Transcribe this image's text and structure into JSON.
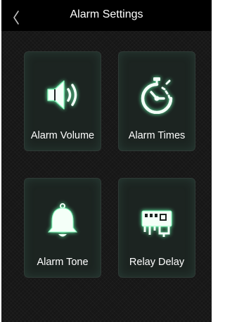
{
  "header": {
    "title": "Alarm Settings",
    "back_icon": "chevron-left-icon"
  },
  "tiles": [
    {
      "label": "Alarm Volume",
      "icon": "speaker-volume-icon"
    },
    {
      "label": "Alarm Times",
      "icon": "stopwatch-icon"
    },
    {
      "label": "Alarm Tone",
      "icon": "bell-icon"
    },
    {
      "label": "Relay Delay",
      "icon": "relay-board-icon"
    }
  ],
  "colors": {
    "background": "#161616",
    "header": "#000000",
    "tile_background": "#1c2421",
    "icon_glow": "#8affc0",
    "icon_fill": "#f4fff8",
    "text": "#ffffff"
  }
}
